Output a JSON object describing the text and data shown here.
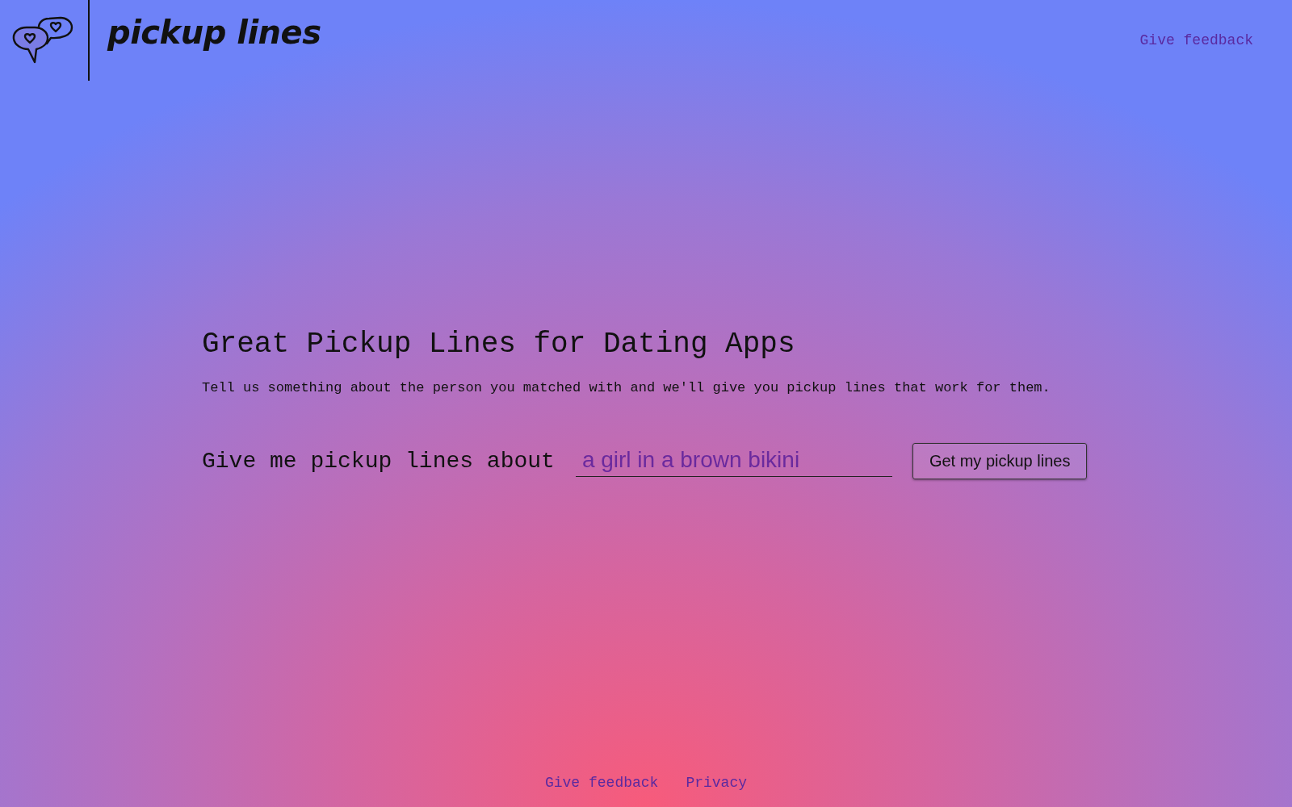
{
  "header": {
    "brand": "pickup lines",
    "feedback_link": "Give feedback"
  },
  "hero": {
    "title": "Great Pickup Lines for Dating Apps",
    "subtitle": "Tell us something about the person you matched with and we'll give you pickup lines that work for them.",
    "prompt": "Give me pickup lines about",
    "input": {
      "placeholder": "a girl in a brown bikini"
    },
    "button": "Get my pickup lines"
  },
  "footer": {
    "links": [
      "Give feedback",
      "Privacy"
    ]
  }
}
